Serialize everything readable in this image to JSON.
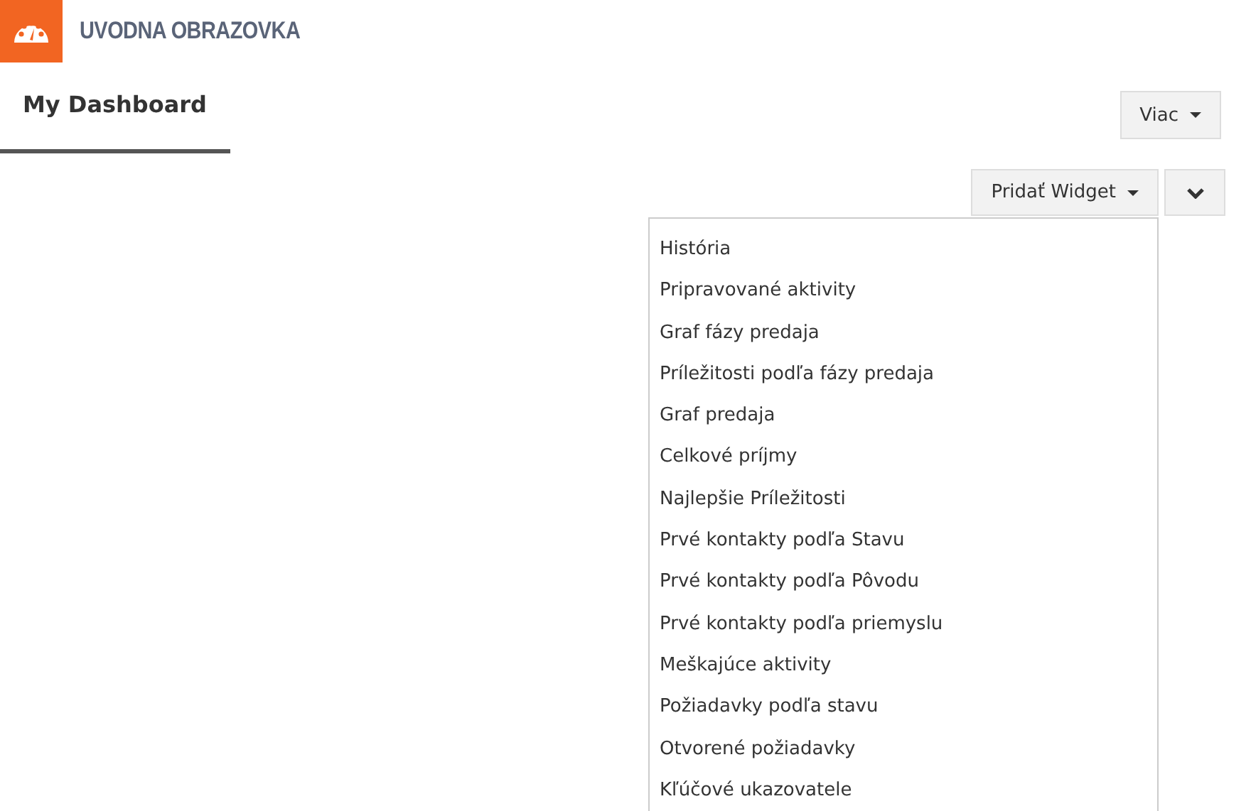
{
  "header": {
    "title": "UVODNA OBRAZOVKA"
  },
  "tabs": [
    {
      "label": "My Dashboard",
      "selected": true
    }
  ],
  "more_button": {
    "label": "Viac"
  },
  "add_widget_button": {
    "label": "Pridať Widget"
  },
  "widget_menu": {
    "items": [
      "História",
      "Pripravované aktivity",
      "Graf fázy predaja",
      "Príležitosti podľa fázy predaja",
      "Graf predaja",
      "Celkové príjmy",
      "Najlepšie Príležitosti",
      "Prvé kontakty podľa Stavu",
      "Prvé kontakty podľa Pôvodu",
      "Prvé kontakty podľa priemyslu",
      "Meškajúce aktivity",
      "Požiadavky podľa stavu",
      "Otvorené požiadavky",
      "Kľúčové ukazovatele"
    ]
  }
}
